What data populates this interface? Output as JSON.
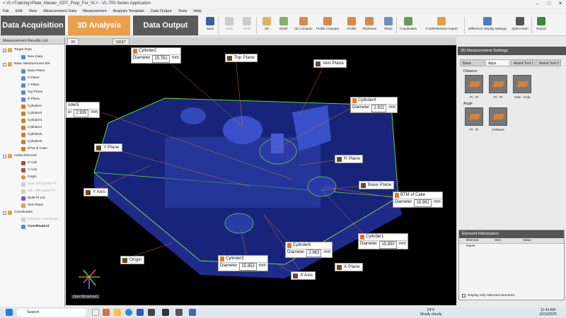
{
  "window": {
    "title": "< VL>Training>Plate_Master_GDT_Prep_For_VL> - VL-700 Series Application"
  },
  "menu": [
    "File",
    "Edit",
    "View",
    "Measurement Data",
    "Measurement",
    "Analysis Template",
    "Data Output",
    "Tools",
    "Help"
  ],
  "modes": {
    "acq": "Data Acquisition",
    "analysis": "3D Analysis",
    "output": "Data Output"
  },
  "toolbar": {
    "save": "Save",
    "undo": "Undo",
    "redo": "Redo",
    "d3": "3D",
    "gdt": "GD&T",
    "compare": "3D Compare",
    "profile_compare": "Profile Compare",
    "profile": "Profile",
    "thickness": "Thickness",
    "plane": "Plane",
    "coordinates": "Coordinates",
    "cad": "CAD/Reference Import",
    "diff": "Difference Display Settings",
    "split": "Split screen",
    "report": "Report"
  },
  "left": {
    "header": "Measurement Results List",
    "items": [
      "Target Data",
      "New Data",
      "Basic Measurement Ele",
      "Base Plane",
      "X Plane",
      "Y Plane",
      "Top Plane",
      "R Plane",
      "Cylinder1",
      "Cylinder2",
      "Cylinder3",
      "Cylinder4",
      "Cylinder5",
      "Cylinder6",
      "BTM of Cake",
      "Assist Element",
      "X Axis",
      "Y Axis",
      "Origin",
      "Max. Diff (GD&T-Fl",
      "Min. Diff (GD&T-Fl",
      "Multi-Pt Ln)",
      "Vert Plane",
      "Coordinates",
      "Machine Coordinate",
      "Coordinates1"
    ]
  },
  "view_tabs": {
    "tab1": "3D",
    "tab2": "GD&T"
  },
  "labels": {
    "cyl2": {
      "name": "Cylinder2",
      "k": "Diameter",
      "v": "15.781",
      "u": "mm"
    },
    "cyl5": {
      "name": "nder5",
      "k": "er",
      "v": "2.935",
      "u": "mm"
    },
    "cyl4": {
      "name": "Cylinder4",
      "k": "Diameter",
      "v": "2.921",
      "u": "mm"
    },
    "btm": {
      "name": "BTM of Cake",
      "k": "Diameter",
      "v": "19.991",
      "u": "mm"
    },
    "cyl1": {
      "name": "Cylinder1",
      "k": "Diameter",
      "v": "15.850",
      "u": "mm"
    },
    "cyl6": {
      "name": "Cylinder6",
      "k": "Diameter",
      "v": "2.963",
      "u": "mm"
    },
    "cyl3": {
      "name": "Cylinder3",
      "k": "Diameter",
      "v": "15.853",
      "u": "mm"
    }
  },
  "planes": {
    "top": "Top Plane",
    "vert": "Vert Plane",
    "y": "Y Plane",
    "r": "R Plane",
    "base": "Base Plane",
    "yaxis": "Y Axis",
    "origin": "Origin",
    "xaxis": "X Axis",
    "xplane": "X Plane"
  },
  "triad": {
    "label": "Coordinates1"
  },
  "right": {
    "header": "3D Measurement Settings",
    "tabs": [
      "Basic",
      "Apps",
      "Assist Tool 1",
      "Assist Tool 2"
    ],
    "distance": "Distance",
    "angle": "Angle",
    "tools_distance": [
      "Pl - Pl",
      "Pl - Pt",
      "Hole - Hole"
    ],
    "tools_angle": [
      "Pl - Pl",
      "3 Planes"
    ]
  },
  "elinfo": {
    "header": "Element Information",
    "cols": [
      "Element Name",
      "Item",
      "Value"
    ],
    "check": "Display only selected elements."
  },
  "taskbar": {
    "search": "Search",
    "weather_temp": "59°F",
    "weather_desc": "Mostly cloudy",
    "time": "11:43 AM",
    "date": "10/10/2025"
  }
}
